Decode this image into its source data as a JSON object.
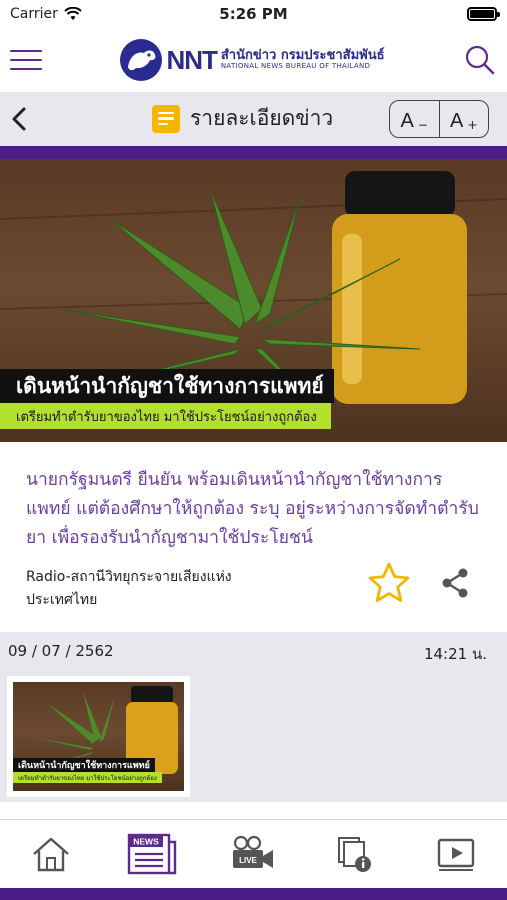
{
  "status_bar": {
    "carrier": "Carrier",
    "time": "5:26 PM",
    "icons": [
      "wifi-icon",
      "battery-icon"
    ]
  },
  "header": {
    "logo_mark": "NNT",
    "logo_thai": "สำนักข่าว กรมประชาสัมพันธ์",
    "logo_english": "NATIONAL NEWS BUREAU OF THAILAND",
    "icons": [
      "hamburger-menu-icon",
      "search-icon"
    ]
  },
  "sub_header": {
    "title": "รายละเอียดข่าว",
    "font_decrease": {
      "letter": "A",
      "sign": "−"
    },
    "font_increase": {
      "letter": "A",
      "sign": "+"
    },
    "icons": [
      "back-chevron-icon",
      "document-icon"
    ]
  },
  "hero": {
    "caption_main": "เดินหน้านำกัญชาใช้ทางการแพทย์",
    "caption_sub": "เตรียมทำตำรับยาของไทย มาใช้ประโยชน์อย่างถูกต้อง"
  },
  "article": {
    "headline": "นายกรัฐมนตรี ยืนยัน พร้อมเดินหน้านำกัญชาใช้ทางการแพทย์ แต่ต้องศึกษาให้ถูกต้อง ระบุ อยู่ระหว่างการจัดทำตำรับยา เพื่อรองรับนำกัญชามาใช้ประโยชน์",
    "source": "Radio-สถานีวิทยุกระจายเสียงแห่งประเทศไทย",
    "icons": [
      "star-icon",
      "share-icon"
    ]
  },
  "meta": {
    "date": "09 / 07 / 2562",
    "time": "14:21 น."
  },
  "thumbnail": {
    "caption_main": "เดินหน้านำกัญชาใช้ทางการแพทย์",
    "caption_sub": "เตรียมทำตำรับยาของไทย มาใช้ประโยชน์อย่างถูกต้อง"
  },
  "bottom_nav": {
    "news_badge": "NEWS",
    "live_badge": "LIVE",
    "items": [
      "home-icon",
      "news-icon",
      "live-camera-icon",
      "documents-info-icon",
      "video-play-icon"
    ]
  },
  "colors": {
    "brand_purple": "#4a1e86",
    "headline_purple": "#6a3fa0",
    "accent_yellow": "#f5b600",
    "caption_green": "#b3df2f",
    "panel_grey": "#e8e7ee"
  }
}
